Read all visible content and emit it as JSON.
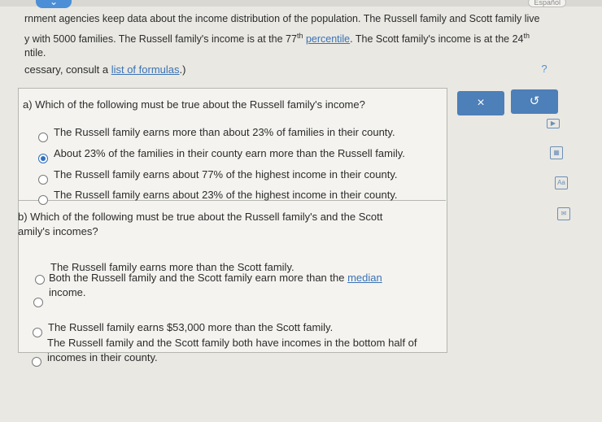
{
  "header": {
    "language": "Español"
  },
  "intro": {
    "line1": "rnment agencies keep data about the income distribution of the population. The Russell family and Scott family live",
    "line2_pre": "y with 5000 families. The Russell family's income is at the 77",
    "line2_sup": "th",
    "line2_link": "percentile",
    "line2_post": ". The Scott family's income is at the 24",
    "line2_sup2": "th",
    "line3": "ntile."
  },
  "formulas": {
    "pre": "cessary, consult a ",
    "link": "list of formulas",
    "post": ".)"
  },
  "help": "?",
  "toolbar": {
    "close": "×",
    "redo": "↺"
  },
  "partA": {
    "question": "a) Which of the following must be true about the Russell family's income?",
    "options": [
      {
        "label": "The Russell family earns more than about 23% of families in their county.",
        "selected": false
      },
      {
        "label": "About 23% of the families in their county earn more than the Russell family.",
        "selected": true
      },
      {
        "label": "The Russell family earns about 77% of the highest income in their county.",
        "selected": false
      },
      {
        "label": "The Russell family earns about 23% of the highest income in their county.",
        "selected": false
      }
    ]
  },
  "partB": {
    "question_l1": "b) Which of the following must be true about the Russell family's and the Scott",
    "question_l2": "amily's incomes?",
    "options": [
      {
        "label": "The Russell family earns more than the Scott family."
      },
      {
        "label_pre": "Both the Russell family and the Scott family earn more than the ",
        "link": "median",
        "label_post": "income."
      },
      {
        "label": "The Russell family earns $53,000 more than the Scott family."
      },
      {
        "label": "The Russell family and the Scott family both have incomes in the bottom half of incomes in their county."
      }
    ]
  },
  "side_icons": [
    "video-icon",
    "calculator-icon",
    "glossary-icon",
    "mail-icon"
  ]
}
